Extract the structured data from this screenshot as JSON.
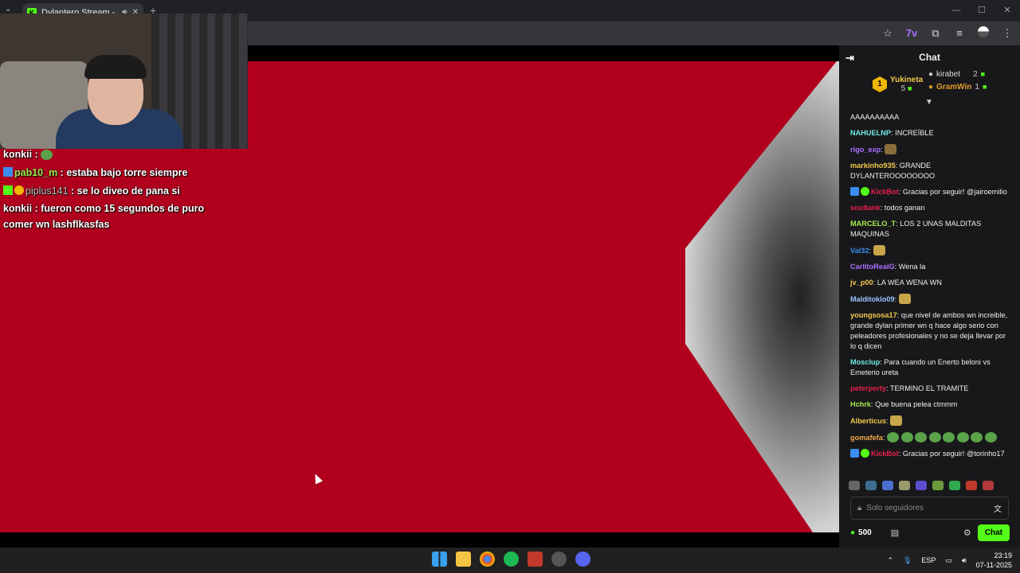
{
  "browser": {
    "tab_title": "Dylantero Stream - Watch L",
    "favicon": "K",
    "new_tab": "+",
    "window_controls": [
      "—",
      "☐",
      "✕"
    ]
  },
  "overlay_chat": [
    {
      "user": "konkii",
      "text": ""
    },
    {
      "user": "pab10_m",
      "text": "estaba bajo torre siempre"
    },
    {
      "user": "piplus141",
      "text": "se lo diveo de pana si"
    },
    {
      "user": "konkii",
      "text": "fueron como 15 segundos de puro comer wn lashflkasfas"
    }
  ],
  "chat": {
    "title": "Chat",
    "leaderboard": {
      "first": {
        "rank": "1",
        "name": "Yukineta",
        "count": "5"
      },
      "second": {
        "name": "kirabet",
        "count": "2"
      },
      "third": {
        "name": "GramWin",
        "count": "1"
      }
    },
    "messages": [
      {
        "user": "",
        "text": "AAAAAAAAAA",
        "color": "#efeff1"
      },
      {
        "user": "NAHUELNP",
        "text": "INCREÍBLE",
        "color": "#6ee7e0"
      },
      {
        "user": "rigo_exp",
        "text": "",
        "color": "#a970ff"
      },
      {
        "user": "markinho935",
        "text": "GRANDE DYLANTEROOOOOOOO",
        "color": "#f2c94c"
      },
      {
        "user": "KickBot",
        "text": "Gracias por seguir! @jairoemilio",
        "color": "#e91e4a"
      },
      {
        "user": "soultank",
        "text": "todos ganan",
        "color": "#e91e4a"
      },
      {
        "user": "MARCELO_T",
        "text": "LOS 2 UNAS MALDITAS MAQUINAS",
        "color": "#a5e94e"
      },
      {
        "user": "Val32",
        "text": "",
        "color": "#3b8df0"
      },
      {
        "user": "CarlitoRealG",
        "text": "Wena la",
        "color": "#a970ff"
      },
      {
        "user": "jv_p00",
        "text": "LA WEA WENA WN",
        "color": "#f2c94c"
      },
      {
        "user": "Malditoklo09",
        "text": "",
        "color": "#9ec3ff"
      },
      {
        "user": "youngsosa17",
        "text": "que nivel de ambos wn increible, grande dylan primer wn q hace algo serio con peleadores profesionales y no se deja llevar por lo q dicen",
        "color": "#f2c94c"
      },
      {
        "user": "Mosclup",
        "text": "Para cuando un Enerto beloni vs Emeterio ureta",
        "color": "#6ee7e0"
      },
      {
        "user": "peterperty",
        "text": "TERMINO EL TRAMITE",
        "color": "#e91e4a"
      },
      {
        "user": "Hchrk",
        "text": "Que buena pelea ctmmm",
        "color": "#a5e94e"
      },
      {
        "user": "Alberticus",
        "text": "",
        "color": "#f2c94c"
      },
      {
        "user": "gomafefa",
        "text": "",
        "color": "#f2a74a"
      },
      {
        "user": "KickBot",
        "text": "Gracias por seguir! @torinho17",
        "color": "#e91e4a"
      }
    ],
    "input_placeholder": "Solo seguidores",
    "points": "500",
    "send_label": "Chat"
  },
  "taskbar": {
    "language": "ESP",
    "time": "23:19",
    "date": "07-11-2025"
  }
}
